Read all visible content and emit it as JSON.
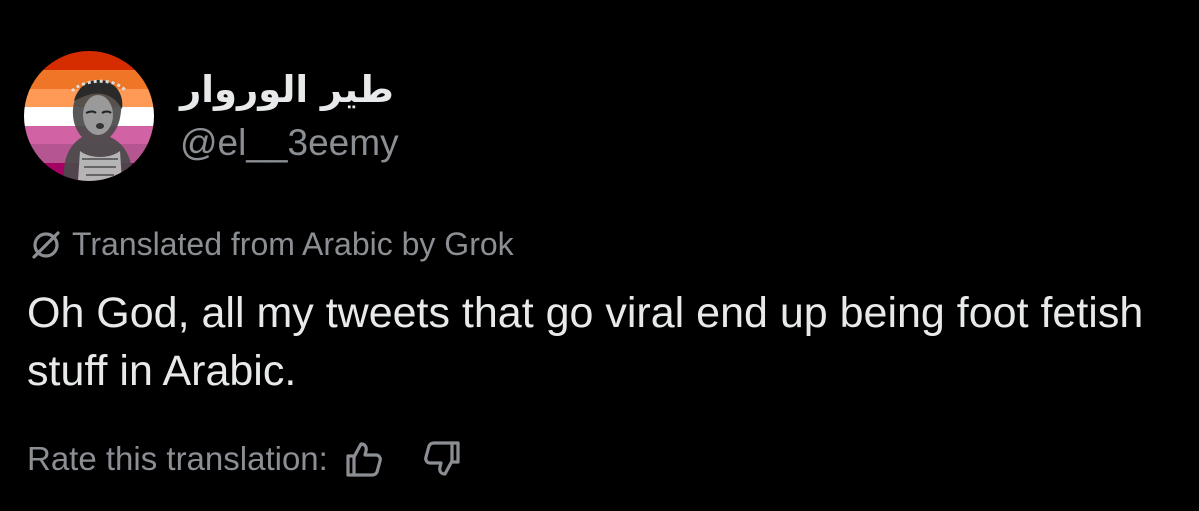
{
  "tweet": {
    "display_name": "طير الوروار",
    "handle": "@el__3eemy",
    "translation_notice": "Translated from Arabic by Grok",
    "text": "Oh God, all my tweets that go viral end up being foot fetish stuff in Arabic.",
    "rate_label": "Rate this translation:"
  },
  "icons": {
    "translation": "null-circle-slash-icon",
    "rate_up": "thumbs-up-icon",
    "rate_down": "thumbs-down-icon"
  },
  "colors": {
    "background": "#000000",
    "primary_text": "#e7e9ea",
    "secondary_text": "#8b8f93",
    "flag_stripes": [
      "#d52d00",
      "#ef7627",
      "#ff9a56",
      "#ffffff",
      "#d162a4",
      "#b55690",
      "#a30262"
    ]
  }
}
